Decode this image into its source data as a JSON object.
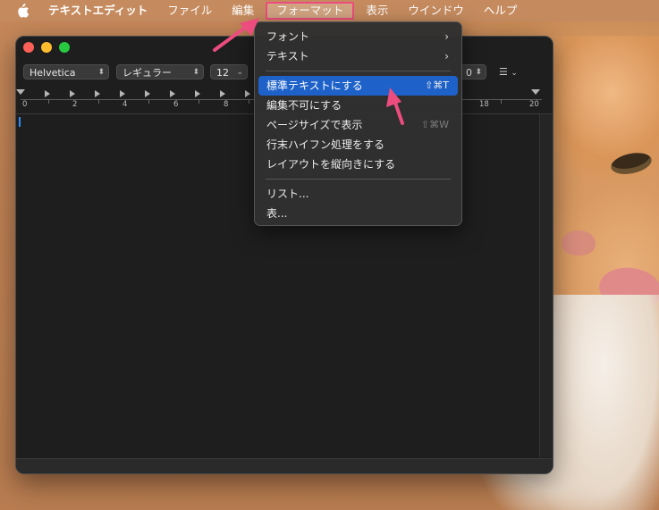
{
  "menubar": {
    "app_name": "テキストエディット",
    "items": [
      "ファイル",
      "編集",
      "フォーマット",
      "表示",
      "ウインドウ",
      "ヘルプ"
    ],
    "active_item": "フォーマット"
  },
  "toolbar": {
    "font_family": "Helvetica",
    "font_style": "レギュラー",
    "font_size": "12",
    "spacing_value": "0"
  },
  "ruler": {
    "numbers": [
      "0",
      "2",
      "4",
      "6",
      "8",
      "18",
      "20"
    ]
  },
  "format_menu": {
    "items": [
      {
        "label": "フォント",
        "submenu": true
      },
      {
        "label": "テキスト",
        "submenu": true
      },
      {
        "label": "標準テキストにする",
        "shortcut": "⇧⌘T",
        "highlighted": true
      },
      {
        "label": "編集不可にする"
      },
      {
        "label": "ページサイズで表示",
        "shortcut": "⇧⌘W",
        "shortcut_disabled": true
      },
      {
        "label": "行末ハイフン処理をする"
      },
      {
        "label": "レイアウトを縦向きにする"
      },
      {
        "label": "リスト..."
      },
      {
        "label": "表..."
      }
    ]
  },
  "colors": {
    "highlight": "#1e62c9",
    "annotation": "#ec4c7e",
    "window_bg": "#1e1e1e"
  },
  "icons": {
    "apple": "apple-logo-icon",
    "submenu": "chevron-right-icon"
  }
}
